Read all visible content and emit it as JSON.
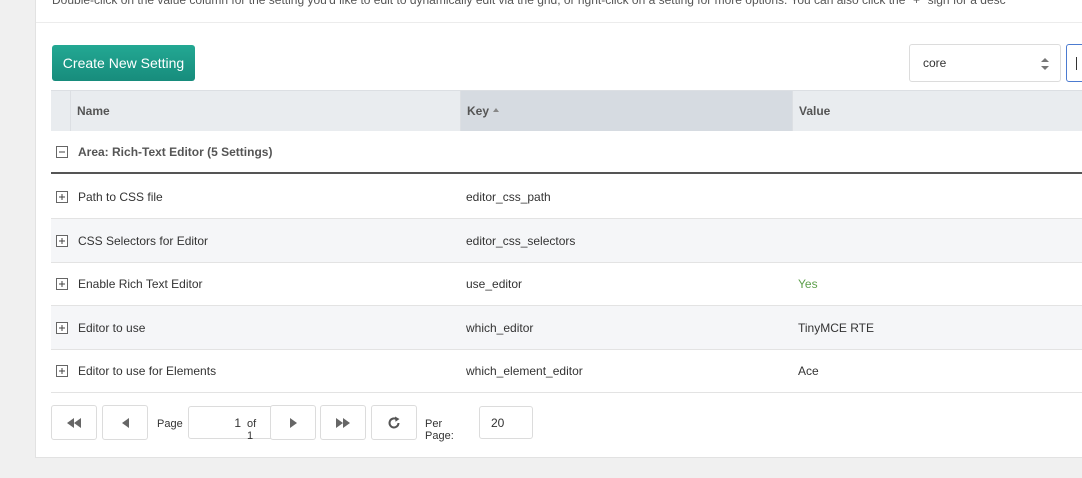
{
  "description": "Double-click on the value column for the setting you'd like to edit to dynamically edit via the grid, or right-click on a setting for more options. You can also click the \"+\" sign for a desc",
  "toolbar": {
    "create_label": "Create New Setting",
    "namespace_value": "core"
  },
  "grid": {
    "columns": {
      "name": "Name",
      "key": "Key",
      "value": "Value"
    },
    "group_label": "Area: Rich-Text Editor (5 Settings)",
    "rows": [
      {
        "name": "Path to CSS file",
        "key": "editor_css_path",
        "value": ""
      },
      {
        "name": "CSS Selectors for Editor",
        "key": "editor_css_selectors",
        "value": ""
      },
      {
        "name": "Enable Rich Text Editor",
        "key": "use_editor",
        "value": "Yes"
      },
      {
        "name": "Editor to use",
        "key": "which_editor",
        "value": "TinyMCE RTE"
      },
      {
        "name": "Editor to use for Elements",
        "key": "which_element_editor",
        "value": "Ace"
      }
    ]
  },
  "pager": {
    "page_label": "Page",
    "page_value": "1",
    "of_label": "of 1",
    "per_page_label": "Per Page:",
    "per_page_value": "20"
  },
  "colors": {
    "accent": "#1e9a8a",
    "yes_value": "#5ea04c"
  }
}
